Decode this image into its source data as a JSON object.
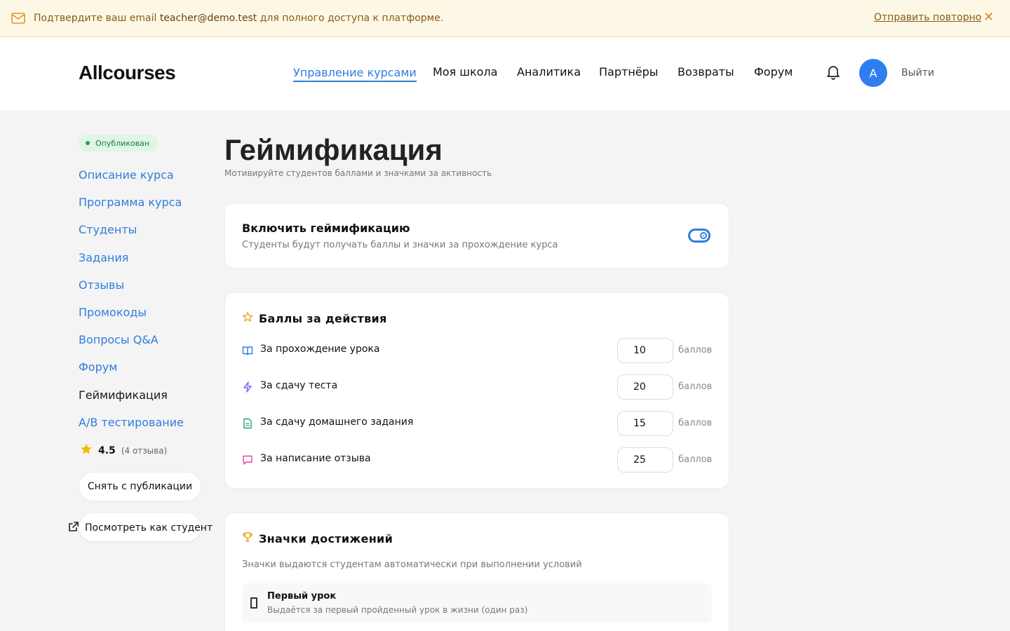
{
  "banner": {
    "text_before": "Подтвердите ваш email ",
    "email": "teacher@demo.test",
    "text_after": " для полного доступа к платформе.",
    "resend": "Отправить повторно",
    "close_glyph": "✕",
    "icon": "mail-icon"
  },
  "header": {
    "logo": "Allcourses",
    "nav": [
      "Управление курсами",
      "Моя школа",
      "Аналитика",
      "Партнёры",
      "Возвраты",
      "Форум"
    ],
    "active_nav": "Управление курсами",
    "avatar_letter": "A",
    "logout": "Выйти",
    "bell_icon": "bell-icon"
  },
  "sidebar": {
    "status": "Опубликован",
    "links": [
      "Описание курса",
      "Программа курса",
      "Студенты",
      "Задания",
      "Отзывы",
      "Промокоды",
      "Вопросы Q&A",
      "Форум",
      "Геймификация",
      "A/B тестирование"
    ],
    "current": "Геймификация",
    "rating": "4.5",
    "rating_count": "(4 отзыва)",
    "unpublish": "Снять с публикации",
    "view_as_student": "Посмотреть как студент"
  },
  "main": {
    "title": "Геймификация",
    "subtitle": "Мотивируйте студентов баллами и значками за активность",
    "toggle_card": {
      "title": "Включить геймификацию",
      "desc": "Студенты будут получать баллы и значки за прохождение курса",
      "enabled": true
    },
    "points": {
      "title": "Баллы за действия",
      "unit": "баллов",
      "items": [
        {
          "label": "За прохождение урока",
          "value": "10",
          "icon": "book-open-icon"
        },
        {
          "label": "За сдачу теста",
          "value": "20",
          "icon": "lightning-icon"
        },
        {
          "label": "За сдачу домашнего задания",
          "value": "15",
          "icon": "document-icon"
        },
        {
          "label": "За написание отзыва",
          "value": "25",
          "icon": "message-icon"
        }
      ]
    },
    "badges": {
      "title": "Значки достижений",
      "desc": "Значки выдаются студентам автоматически при выполнении условий",
      "items": [
        {
          "title": "Первый урок",
          "desc": "Выдаётся за первый пройденный урок в жизни (один раз)"
        }
      ]
    }
  },
  "colors": {
    "accent": "#2f7ddb",
    "banner_bg": "#fdf8e6",
    "published_green": "#22a34a",
    "star": "#f5b800"
  }
}
